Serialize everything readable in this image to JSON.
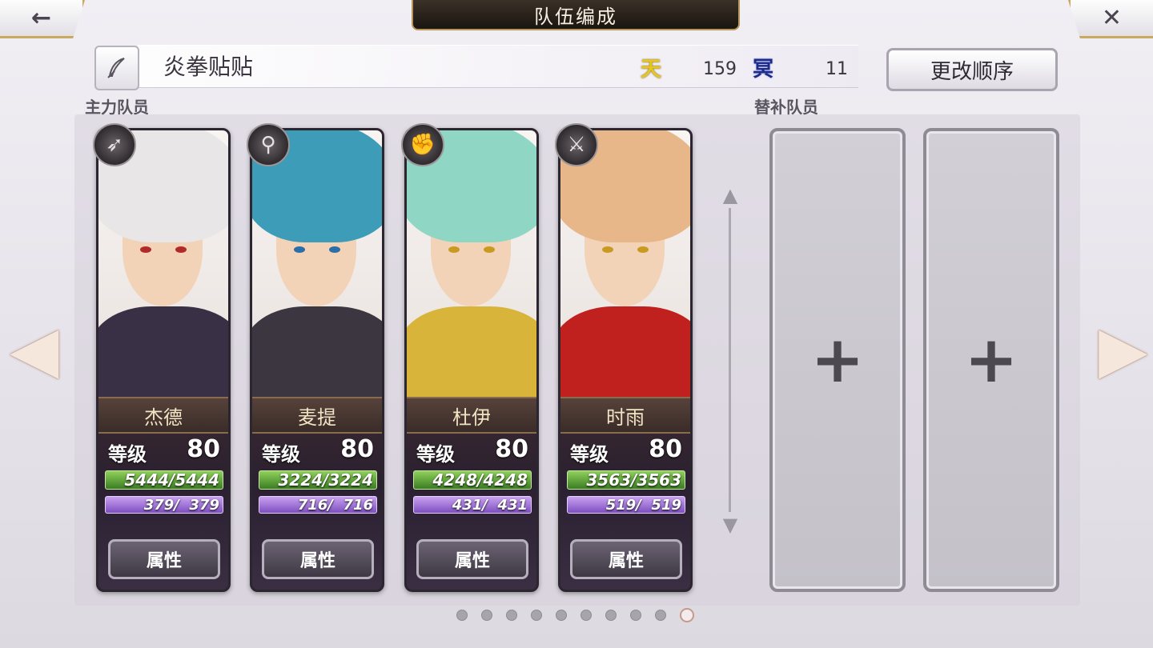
{
  "header": {
    "title": "队伍编成",
    "back_icon": "←",
    "close_icon": "✕"
  },
  "team": {
    "name": "炎拳贴贴",
    "sky_label": "天",
    "sky_value": "159",
    "dark_label": "冥",
    "dark_value": "11",
    "reorder_label": "更改顺序"
  },
  "sections": {
    "main_label": "主力队员",
    "reserve_label": "替补队员"
  },
  "members": [
    {
      "name": "杰德",
      "level_label": "等级",
      "level": "80",
      "hp": "5444/5444",
      "sp": "379/  379",
      "attr_label": "属性",
      "weapon": "spear-icon",
      "weapon_glyph": "➶",
      "hair": "#e8e6e6",
      "outfit": "#3a3046",
      "eye": "#b02a2a"
    },
    {
      "name": "麦提",
      "level_label": "等级",
      "level": "80",
      "hp": "3224/3224",
      "sp": "716/  716",
      "attr_label": "属性",
      "weapon": "staff-icon",
      "weapon_glyph": "⚲",
      "hair": "#3d9cb8",
      "outfit": "#3b3640",
      "eye": "#2a6fa8"
    },
    {
      "name": "杜伊",
      "level_label": "等级",
      "level": "80",
      "hp": "4248/4248",
      "sp": "431/  431",
      "attr_label": "属性",
      "weapon": "gauntlet-icon",
      "weapon_glyph": "✊",
      "hair": "#8fd6c4",
      "outfit": "#d9b43a",
      "eye": "#c89a22"
    },
    {
      "name": "时雨",
      "level_label": "等级",
      "level": "80",
      "hp": "3563/3563",
      "sp": "519/  519",
      "attr_label": "属性",
      "weapon": "sword-icon",
      "weapon_glyph": "⚔",
      "hair": "#e7b78a",
      "outfit": "#c0201e",
      "eye": "#c89a22"
    }
  ],
  "reserve_slots": [
    {
      "plus": "+"
    },
    {
      "plus": "+"
    }
  ],
  "nav": {
    "left_arrow": "◀",
    "right_arrow": "▶"
  },
  "pagination": {
    "count": 10,
    "active_index": 9
  }
}
